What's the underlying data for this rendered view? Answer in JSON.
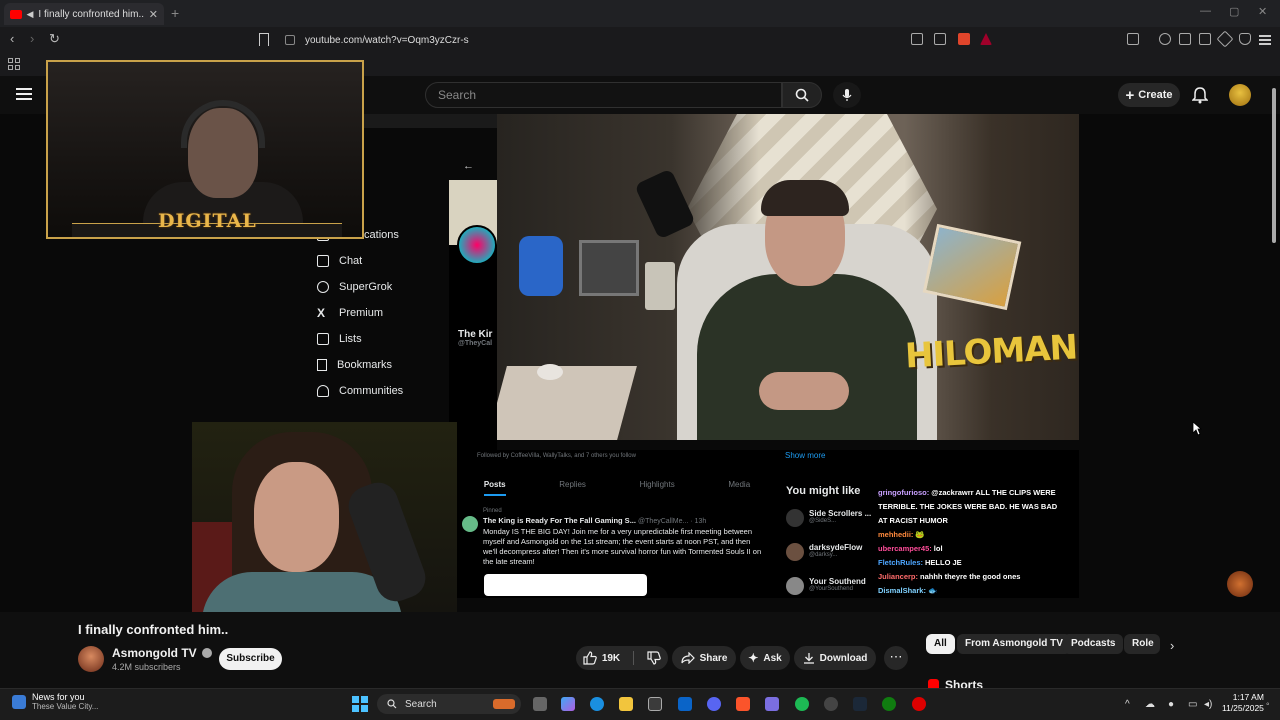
{
  "browser": {
    "tab_title": "I finally confronted him... - Yo",
    "tab_close": "✕",
    "new_tab": "+",
    "url": "youtube.com/watch?v=Oqm3yzCzr-s"
  },
  "youtube": {
    "search_placeholder": "Search",
    "create_label": "Create",
    "video_title": "I finally confronted him..",
    "channel_name": "Asmongold TV",
    "subscribers": "4.2M subscribers",
    "subscribe_label": "Subscribe",
    "like_count": "19K",
    "share_label": "Share",
    "ask_label": "Ask",
    "download_label": "Download",
    "more_label": "⋯",
    "chips": [
      "All",
      "From Asmongold TV",
      "Podcasts",
      "Role"
    ],
    "shorts_label": "Shorts"
  },
  "stream_overlay": {
    "webcam_logo": "DIGITAL",
    "hiloman_text": "HILOMAN"
  },
  "twitter": {
    "nav": [
      {
        "label": "Notifications",
        "icon": "bell-icon"
      },
      {
        "label": "Chat",
        "icon": "mail-icon"
      },
      {
        "label": "SuperGrok",
        "icon": "grok-icon"
      },
      {
        "label": "Premium",
        "icon": "x-icon"
      },
      {
        "label": "Lists",
        "icon": "list-icon"
      },
      {
        "label": "Bookmarks",
        "icon": "bookmark-icon"
      },
      {
        "label": "Communities",
        "icon": "communities-icon"
      }
    ],
    "profile_name": "The Kir",
    "profile_handle": "@TheyCal",
    "followed_by": "Followed by CoffeeVilla, WallyTalks, and 7 others you follow",
    "show_more": "Show more",
    "tabs": [
      "Posts",
      "Replies",
      "Highlights",
      "Media"
    ],
    "pinned": "Pinned",
    "post_author": "The King is Ready For The Fall Gaming S...",
    "post_handle": "@TheyCallMe... · 13h",
    "post_text": "Monday IS THE BIG DAY! Join me for a very unpredictable first meeting between myself and Asmongold on the 1st stream; the event starts at noon PST, and then we'll decompress after! Then it's more survival horror fun with Tormented Souls II on the late stream!",
    "you_might_like": "You might like",
    "suggestions": [
      {
        "name": "Side Scrollers ...",
        "handle": "@SideS..."
      },
      {
        "name": "darksydeFlow",
        "handle": "@darksy..."
      },
      {
        "name": "Your Southend",
        "handle": "@YourSouthend"
      }
    ]
  },
  "chat": [
    {
      "user": "gringofurioso:",
      "message": "@zackrawrr ALL THE CLIPS WERE TERRIBLE. THE JOKES WERE BAD. HE WAS BAD AT RACIST HUMOR",
      "color": "#c8a0ff"
    },
    {
      "user": "mehhedii:",
      "message": "🐸",
      "color": "#ff8a3d"
    },
    {
      "user": "ubercamper45:",
      "message": "lol",
      "color": "#ff4d9a"
    },
    {
      "user": "FletchRules:",
      "message": "HELLO JE",
      "color": "#4da6ff"
    },
    {
      "user": "Juliancerp:",
      "message": "nahhh theyre the good ones",
      "color": "#ff6b6b"
    },
    {
      "user": "DismalShark:",
      "message": "🐟",
      "color": "#7fd1ff"
    }
  ],
  "taskbar": {
    "news_title": "News for you",
    "news_sub": "These Value City...",
    "search_label": "Search",
    "time": "1:17 AM",
    "date": "11/25/2025"
  },
  "colors": {
    "youtube_red": "#ff0000",
    "twitter_blue": "#1d9bf0",
    "webcam_border": "#c9a24a",
    "windows_accent": "#4cc2ff"
  }
}
